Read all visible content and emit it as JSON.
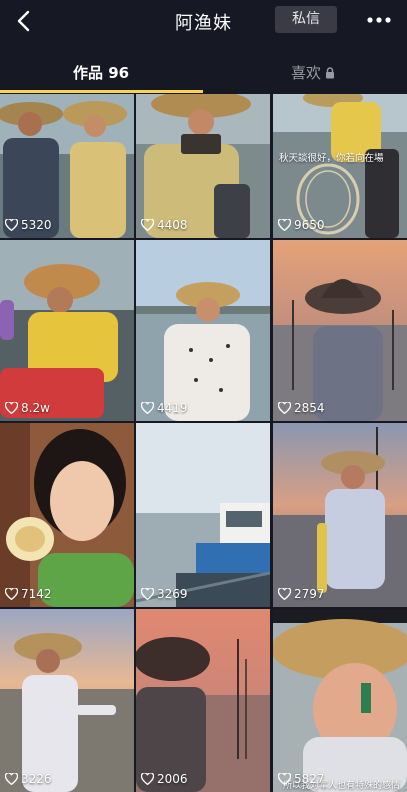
{
  "header": {
    "title": "阿渔妹",
    "message_button": "私信",
    "back_icon": "back-arrow-icon",
    "more_icon": "more-dots-icon"
  },
  "tabs": [
    {
      "label": "作品 96",
      "active": true
    },
    {
      "label": "喜欢",
      "locked": true,
      "active": false
    }
  ],
  "accent_color": "#fcd34d",
  "videos": [
    {
      "likes": "5320"
    },
    {
      "likes": "4408"
    },
    {
      "likes": "9650",
      "caption": "秋天談很好，你若向在場"
    },
    {
      "likes": "8.2w"
    },
    {
      "likes": "4419"
    },
    {
      "likes": "2854"
    },
    {
      "likes": "7142"
    },
    {
      "likes": "3269"
    },
    {
      "likes": "2797"
    },
    {
      "likes": "3226"
    },
    {
      "likes": "2006"
    },
    {
      "likes": "5827",
      "caption": "所以我对军人也有特殊的感情"
    }
  ]
}
